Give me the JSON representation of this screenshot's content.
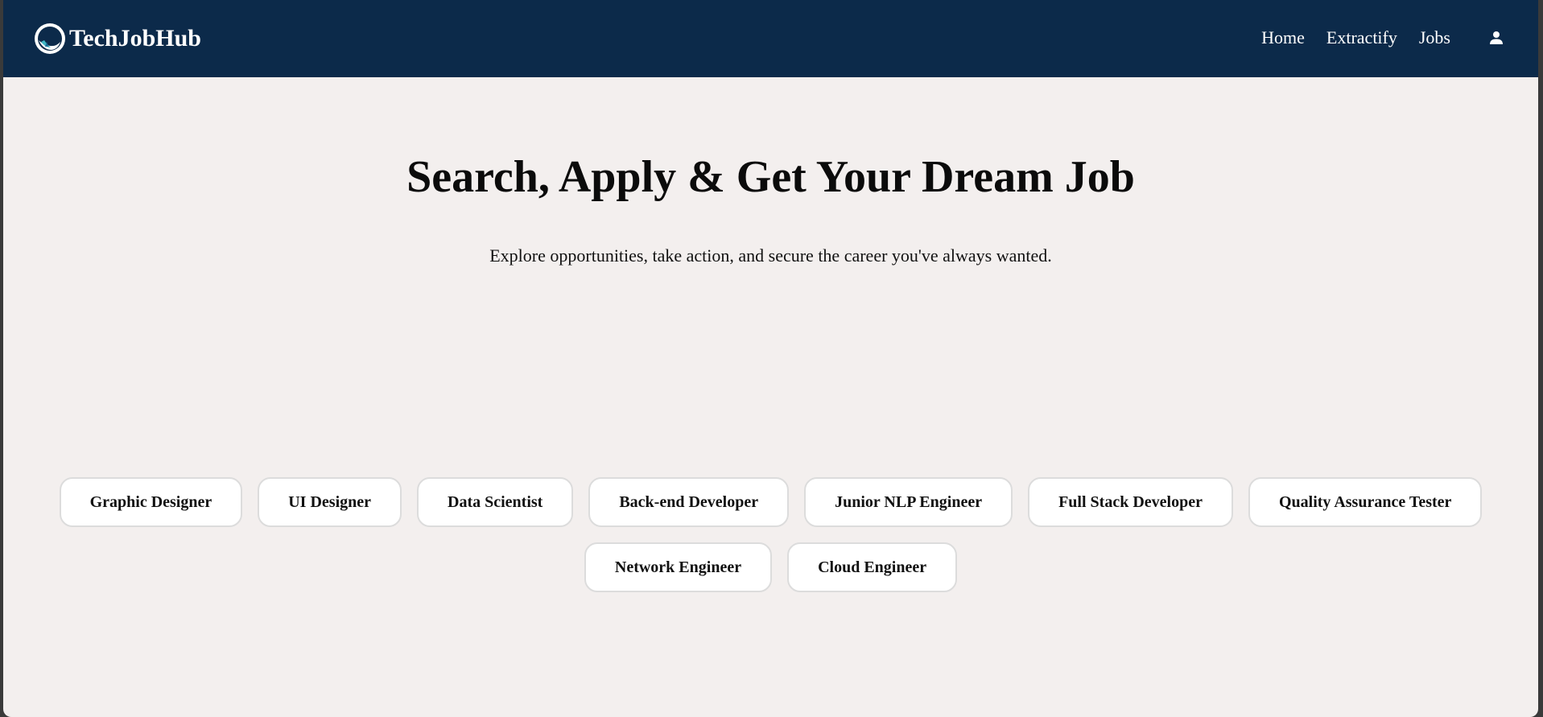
{
  "brand": {
    "name": "TechJobHub"
  },
  "nav": {
    "items": [
      {
        "label": "Home"
      },
      {
        "label": "Extractify"
      },
      {
        "label": "Jobs"
      }
    ],
    "profile_icon": "user-icon"
  },
  "hero": {
    "title": "Search, Apply & Get Your Dream Job",
    "subtitle": "Explore opportunities, take action, and secure the career you've always wanted."
  },
  "job_categories": [
    {
      "label": "Graphic Designer"
    },
    {
      "label": "UI Designer"
    },
    {
      "label": "Data Scientist"
    },
    {
      "label": "Back-end Developer"
    },
    {
      "label": "Junior NLP Engineer"
    },
    {
      "label": "Full Stack Developer"
    },
    {
      "label": "Quality Assurance Tester"
    },
    {
      "label": "Network Engineer"
    },
    {
      "label": "Cloud Engineer"
    }
  ],
  "colors": {
    "navbar_bg": "#0c2a4a",
    "page_bg": "#f3efee",
    "chip_bg": "#ffffff",
    "chip_border": "#dcdcdc",
    "text": "#111111"
  }
}
